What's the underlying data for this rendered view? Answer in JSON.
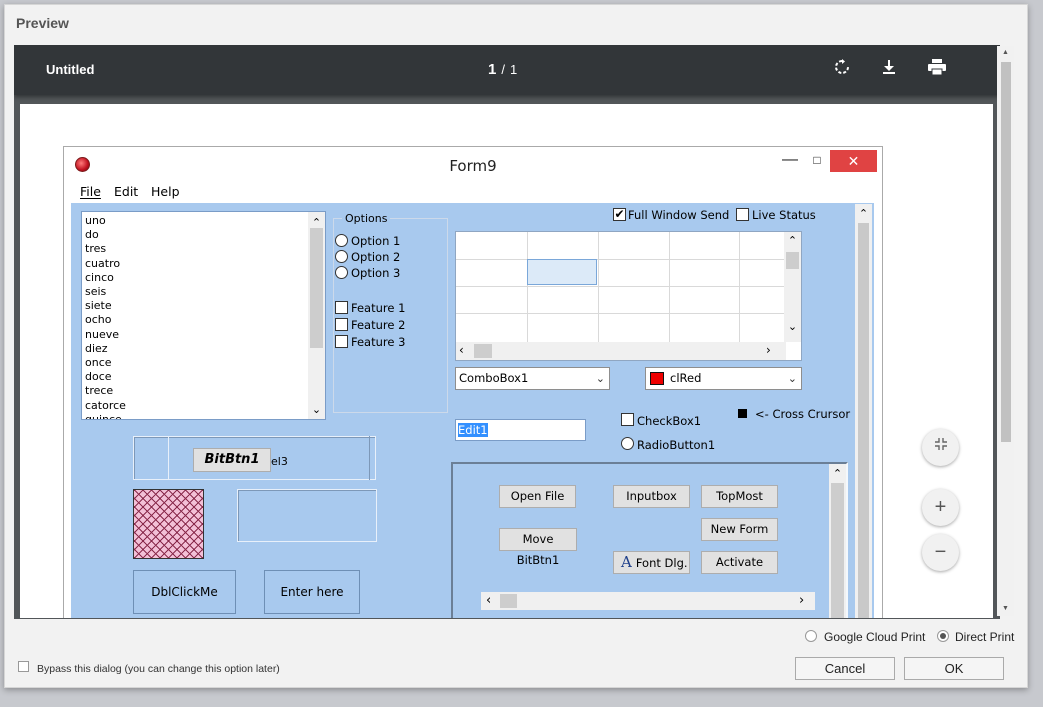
{
  "dialog": {
    "title": "Preview",
    "viewer": {
      "doc_title": "Untitled",
      "page_current": "1",
      "page_sep": "/",
      "page_total": "1",
      "icons": [
        "rotate-icon",
        "download-icon",
        "print-icon"
      ]
    },
    "zoom": {
      "fit": "⇲",
      "plus": "+",
      "minus": "−"
    },
    "print_options": {
      "cloud_label": "Google Cloud Print",
      "direct_label": "Direct Print",
      "selected": "Direct Print"
    },
    "bypass_label": "Bypass this dialog (you can change this option later)",
    "cancel_label": "Cancel",
    "ok_label": "OK"
  },
  "form": {
    "title": "Form9",
    "menu": [
      {
        "label": "File",
        "key": "F"
      },
      {
        "label": "Edit",
        "key": "E"
      },
      {
        "label": "Help",
        "key": "H"
      }
    ],
    "listbox_items": [
      "uno",
      "do",
      "tres",
      "cuatro",
      "cinco",
      "seis",
      "siete",
      "ocho",
      "nueve",
      "diez",
      "once",
      "doce",
      "trece",
      "catorce",
      "quince"
    ],
    "options_group": {
      "title": "Options",
      "radios": [
        "Option 1",
        "Option 2",
        "Option 3"
      ],
      "checks": [
        "Feature 1",
        "Feature 2",
        "Feature 3"
      ]
    },
    "bitbtn_label": "BitBtn1",
    "panel_label": "el3",
    "dblclick_label": "DblClickMe",
    "enter_label": "Enter here",
    "full_window_send": {
      "label": "Full Window Send",
      "checked": true
    },
    "live_status": {
      "label": "Live Status",
      "checked": false
    },
    "combo1_value": "ComboBox1",
    "color_combo_value": "clRed",
    "color_combo_swatch": "#ee0000",
    "edit1_value": "Edit1",
    "checkbox1_label": "CheckBox1",
    "radiobutton1_label": "RadioButton1",
    "cross_cursor_label": "<- Cross Crursor",
    "buttons": {
      "open_file": "Open File",
      "inputbox": "Inputbox",
      "topmost": "TopMost",
      "new_form": "New Form",
      "move_bitbtn": "Move BitBtn1",
      "font_dlg": "Font Dlg.",
      "font_dlg_glyph": "A",
      "activate": "Activate"
    }
  }
}
